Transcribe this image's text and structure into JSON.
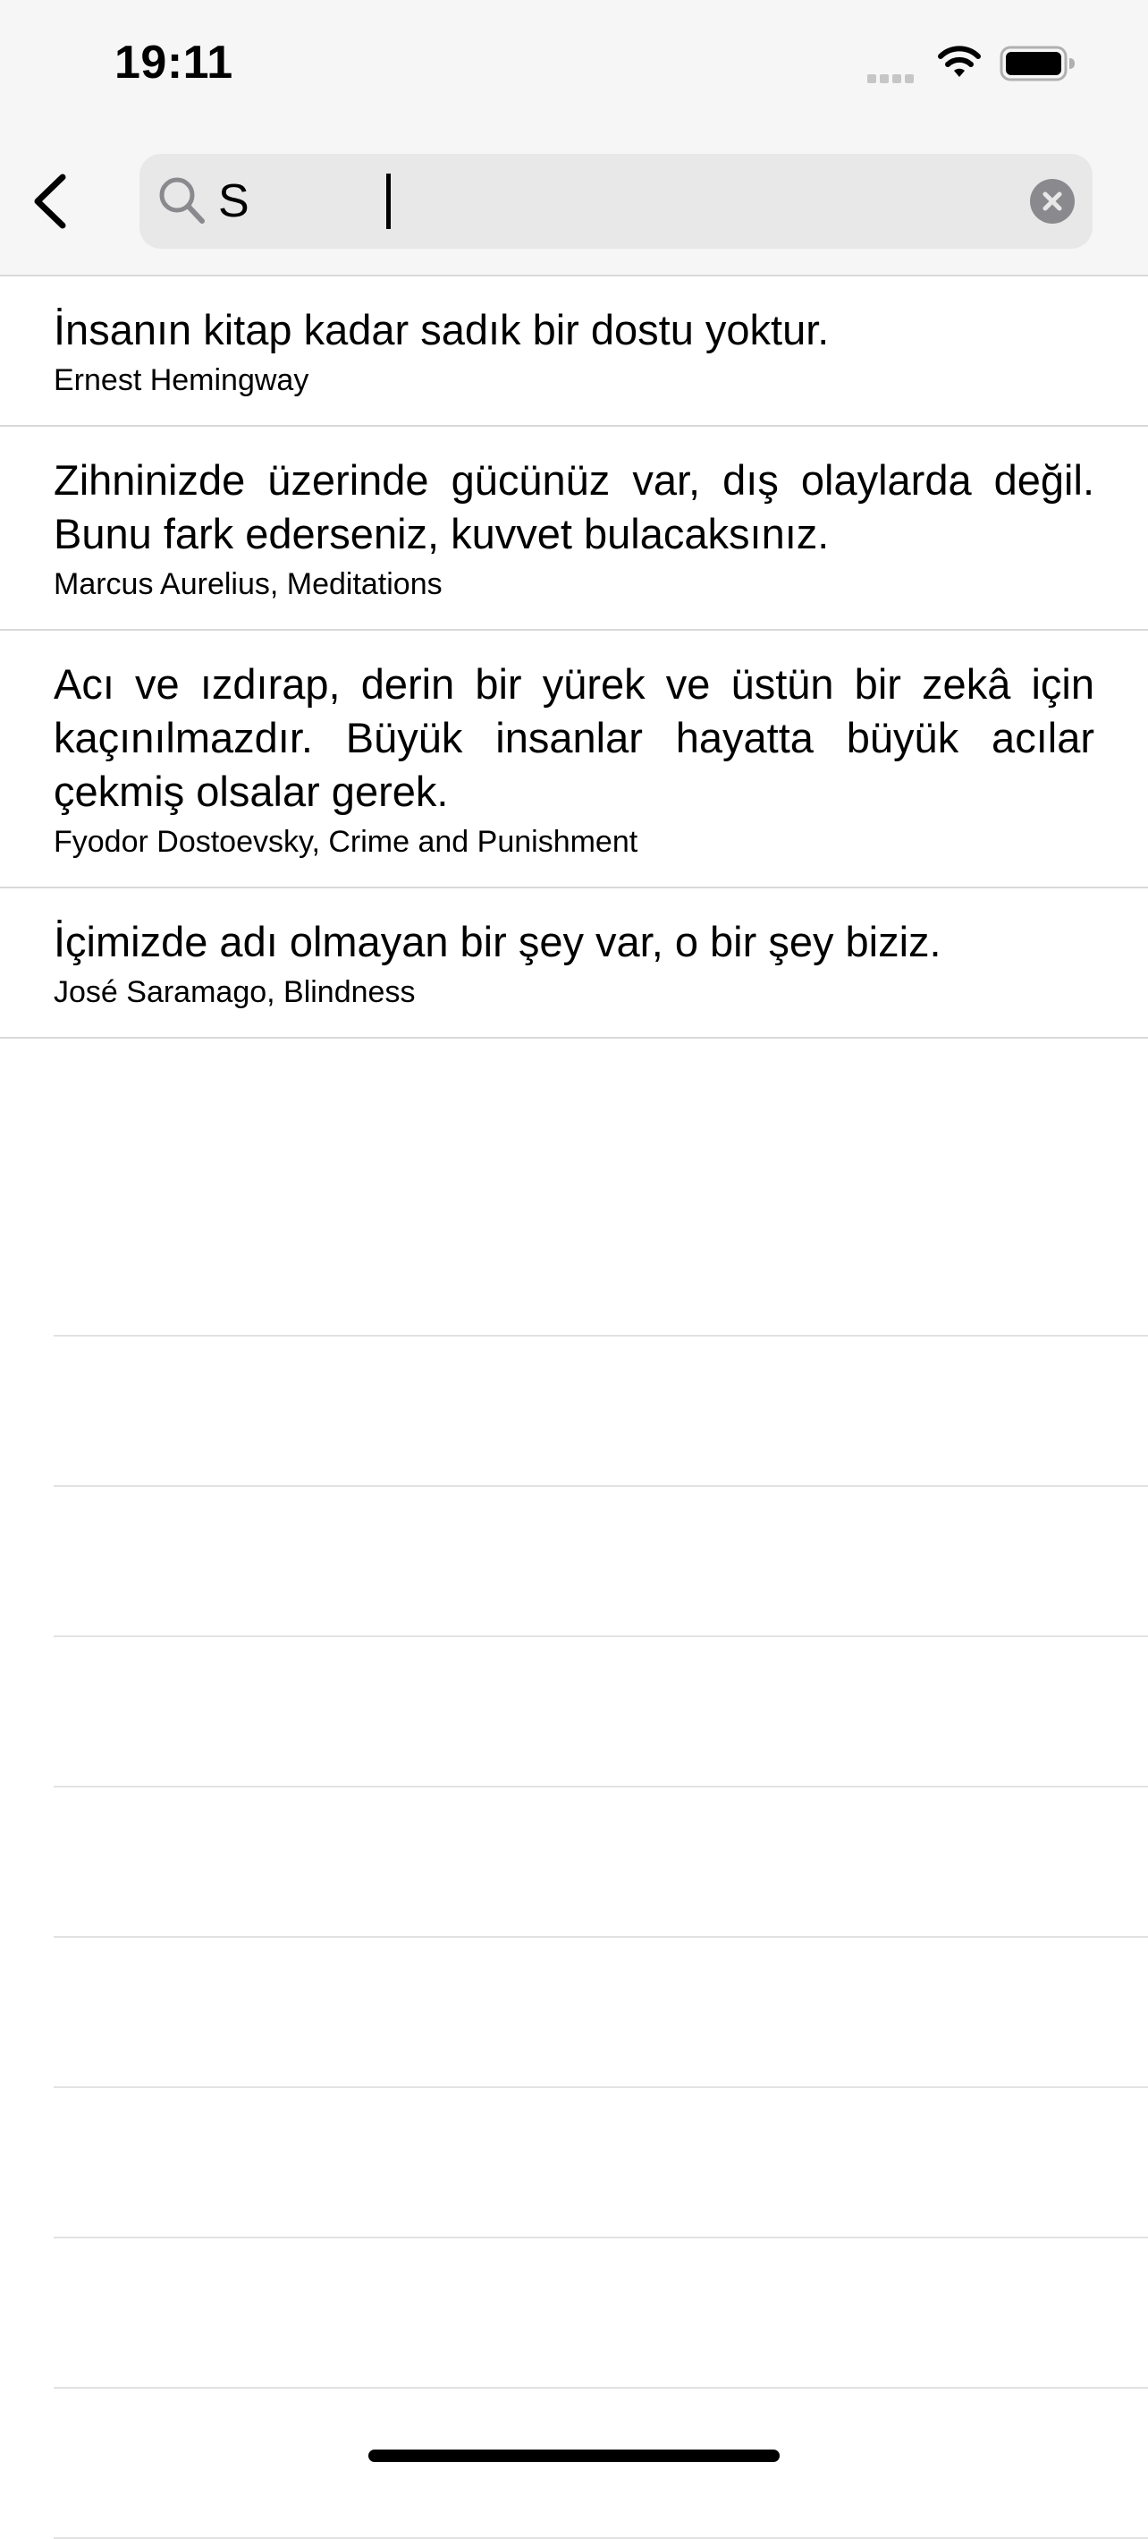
{
  "status_bar": {
    "time": "19:11"
  },
  "search": {
    "value": "S"
  },
  "results": [
    {
      "quote": "İnsanın kitap kadar sadık bir dostu yoktur.",
      "source": "Ernest Hemingway"
    },
    {
      "quote": "Zihninizde üzerinde gücünüz var, dış olaylarda değil. Bunu fark ederseniz, kuvvet bulacaksınız.",
      "source": "Marcus Aurelius, Meditations"
    },
    {
      "quote": "Acı ve ızdırap, derin bir yürek ve üstün bir zekâ için kaçınılmazdır. Büyük insanlar hayatta büyük acılar çekmiş olsalar gerek.",
      "source": "Fyodor Dostoevsky, Crime and Punishment"
    },
    {
      "quote": "İçimizde adı olmayan bir şey var, o bir şey biziz.",
      "source": "José Saramago, Blindness"
    }
  ],
  "icons": {
    "back": "chevron-left-icon",
    "search": "magnifier-icon",
    "clear": "x-circle-icon",
    "wifi": "wifi-icon",
    "battery": "battery-icon",
    "signal": "cellular-signal-icon"
  }
}
